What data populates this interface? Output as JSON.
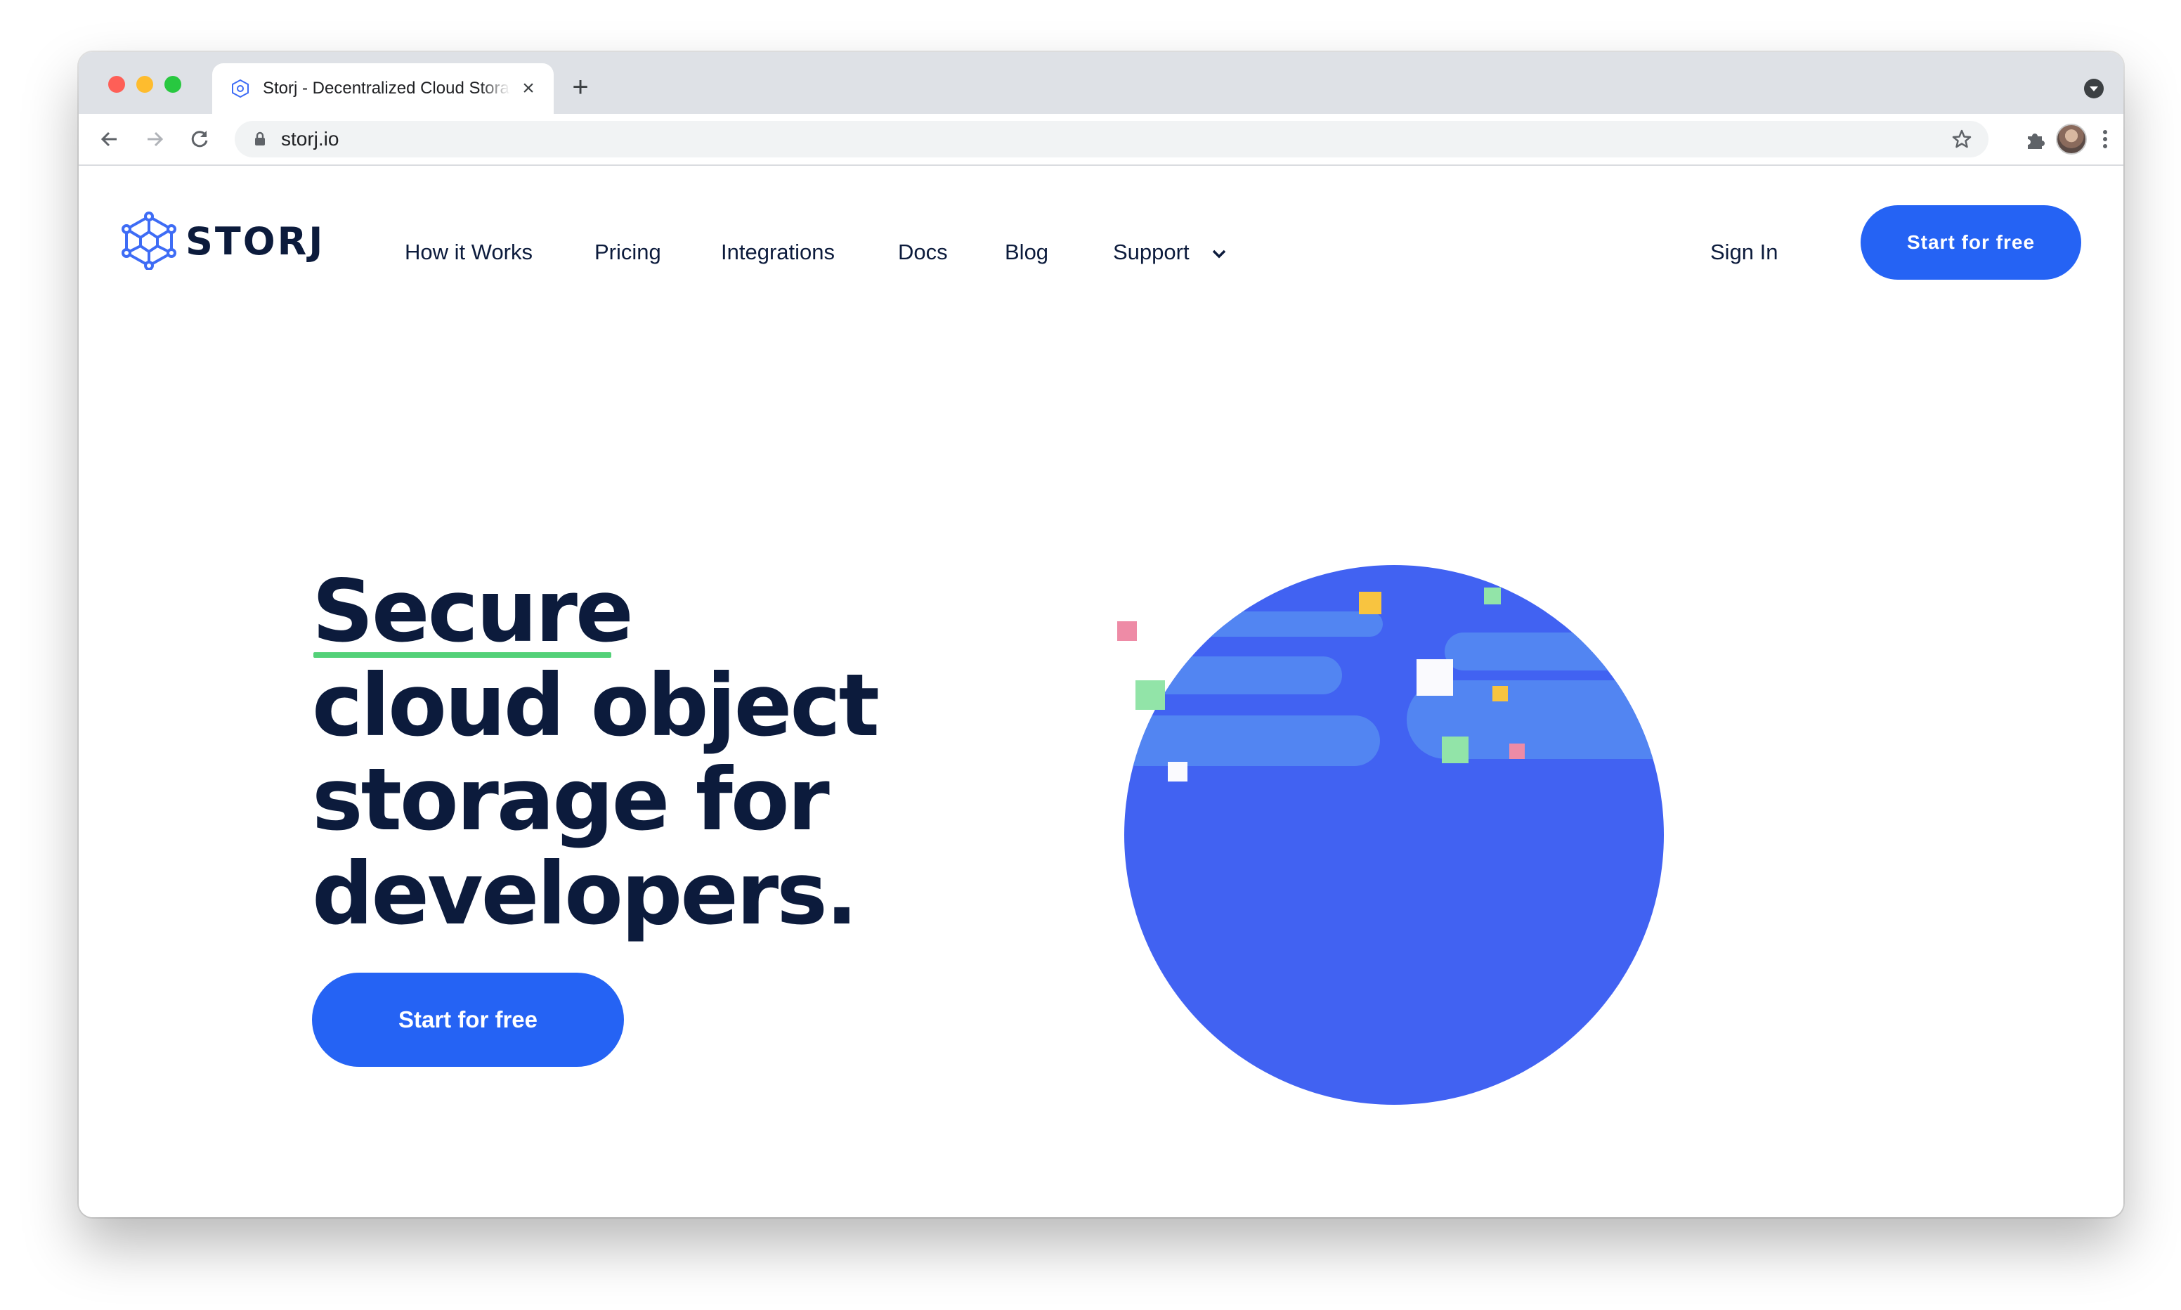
{
  "browser": {
    "tab_title": "Storj - Decentralized Cloud Storage",
    "tab_close": "×",
    "new_tab": "+",
    "url": "storj.io",
    "icons": {
      "back": "arrow-left-icon",
      "forward": "arrow-right-icon",
      "reload": "reload-icon",
      "lock": "lock-icon",
      "star": "star-icon",
      "extensions": "puzzle-icon",
      "menu": "kebab-icon"
    }
  },
  "site": {
    "logo_text": "STORJ",
    "nav": {
      "how_it_works": "How it Works",
      "pricing": "Pricing",
      "integrations": "Integrations",
      "docs": "Docs",
      "blog": "Blog",
      "support": "Support"
    },
    "sign_in": "Sign In",
    "cta_top": "Start for free"
  },
  "hero": {
    "line1": "Secure",
    "line2": "cloud object",
    "line3": "storage for",
    "line4": "developers.",
    "cta": "Start for free"
  },
  "colors": {
    "brand_blue": "#2563f4",
    "navy_text": "#0c1b3c",
    "underline_green": "#53d178",
    "globe_blue": "#4162f2",
    "globe_band": "#5285f2",
    "square_yellow": "#f8c440",
    "square_green": "#92e4a8",
    "square_pink": "#ee8ba6",
    "square_white": "#fafafe"
  }
}
